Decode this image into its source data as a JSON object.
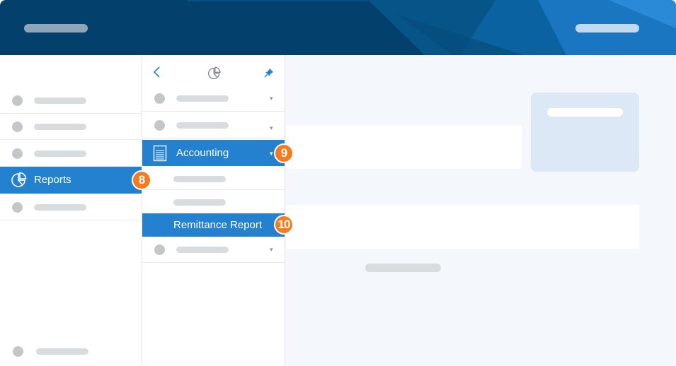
{
  "sidebar": {
    "active_item_label": "Reports",
    "active_item_icon": "pie-chart-icon"
  },
  "subpanel": {
    "back_icon": "chevron-left-icon",
    "section_icon": "pie-chart-icon",
    "pin_icon": "pin-icon",
    "group_label": "Accounting",
    "group_icon": "document-list-icon",
    "selected_child_label": "Remittance Report",
    "chevron": "▾"
  },
  "callouts": {
    "reports": "8",
    "accounting": "9",
    "remittance": "10"
  },
  "colors": {
    "header": "#04406c",
    "accent": "#2481cf",
    "badge": "#f47b20",
    "background": "#f4f7fb"
  }
}
